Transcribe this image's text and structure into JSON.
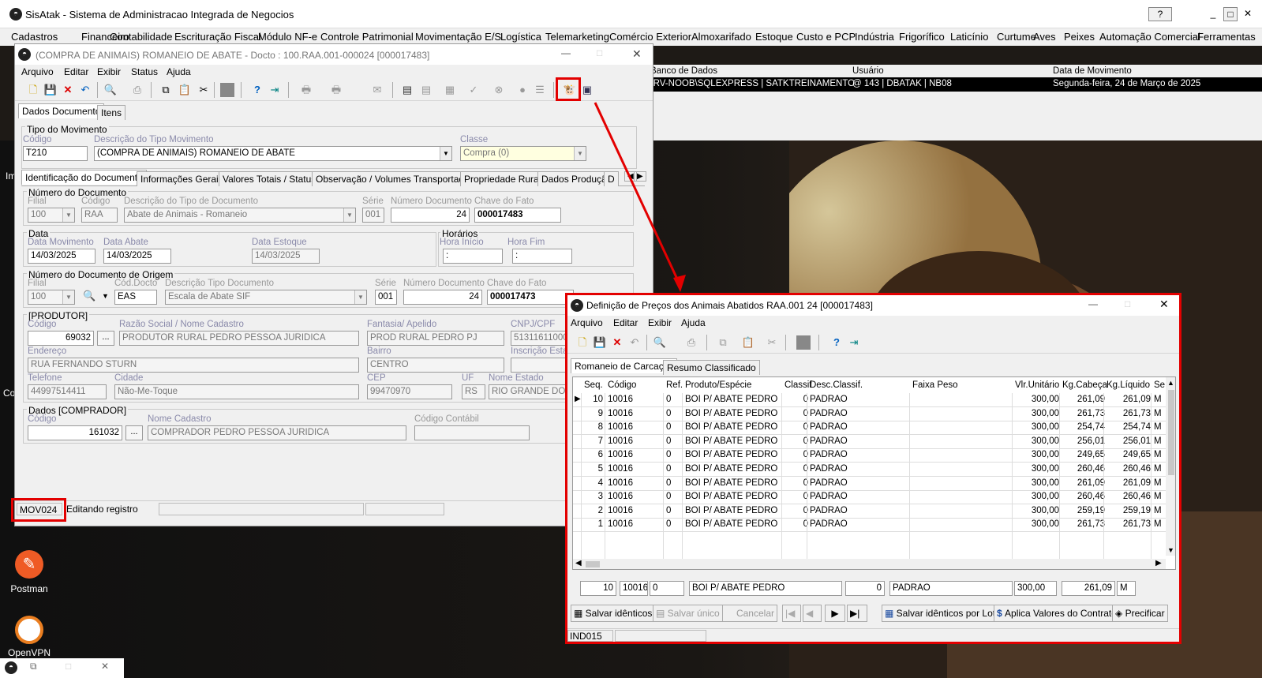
{
  "app": {
    "title": "SisAtak - Sistema de Administracao Integrada de Negocios",
    "help": "?"
  },
  "menu": [
    "Cadastros",
    "Financeiro",
    "Contabilidade",
    "Escrituração Fiscal",
    "Módulo NF-e",
    "Controle Patrimonial",
    "Movimentação E/S",
    "Logística",
    "Telemarketing",
    "Comércio Exterior",
    "Almoxarifado",
    "Estoque",
    "Custo e PCP",
    "Indústria",
    "Frigorífico",
    "Laticínio",
    "Curtume",
    "Aves",
    "Peixes",
    "Automação Comercial",
    "Ferramentas"
  ],
  "info": {
    "h_banco": "Banco de Dados",
    "h_usuario": "Usuário",
    "h_data": "Data de Movimento",
    "banco": "SRV-NOOB\\SQLEXPRESS | SATKTREINAMENTO",
    "usuario": "@ 143 | DBATAK | NB08",
    "data": "Segunda-feira, 24 de Março de 2025"
  },
  "w1": {
    "title": "(COMPRA DE ANIMAIS) ROMANEIO DE ABATE - Docto : 100.RAA.001-000024 [000017483]",
    "menu": [
      "Arquivo",
      "Editar",
      "Exibir",
      "Status",
      "Ajuda"
    ],
    "tabs": [
      "Dados Documento",
      "Itens"
    ],
    "tipo_grp": "Tipo do Movimento",
    "l_codigo": "Código",
    "codigo": "T210",
    "l_desc": "Descrição do Tipo Movimento",
    "desc": "(COMPRA DE ANIMAIS) ROMANEIO DE ABATE",
    "l_classe": "Classe",
    "classe": "Compra (0)",
    "subtabs": [
      "Identificação do Documento",
      "Informações Gerais",
      "Valores Totais / Status",
      "Observação / Volumes Transportados",
      "Propriedade Rural",
      "Dados Produção",
      "D"
    ],
    "num_grp": "Número do Documento",
    "l_filial": "Filial",
    "filial": "100",
    "l_cod": "Código",
    "cod": "RAA",
    "l_desc_doc": "Descrição do Tipo de Documento",
    "desc_doc": "Abate de Animais - Romaneio",
    "l_serie": "Série",
    "serie": "001",
    "l_numdoc": "Número Documento",
    "numdoc": "24",
    "l_chave": "Chave do Fato",
    "chave": "000017483",
    "data_grp": "Data",
    "l_dmov": "Data Movimento",
    "dmov": "14/03/2025",
    "l_dabate": "Data Abate",
    "dabate": "14/03/2025",
    "l_dest": "Data Estoque",
    "dest": "14/03/2025",
    "hor_grp": "Horários",
    "l_hini": "Hora Início",
    "hini": ":",
    "l_hfim": "Hora Fim",
    "hfim": ":",
    "orig_grp": "Número do Documento de Origem",
    "o_filial": "100",
    "l_cdocto": "Cód.Docto",
    "cdocto": "EAS",
    "l_odesc": "Descrição Tipo Documento",
    "odesc": "Escala de Abate SIF",
    "o_serie": "001",
    "o_num": "24",
    "o_chave": "000017473",
    "prod_grp": "[PRODUTOR]",
    "p_codigo": "69032",
    "l_razao": "Razão Social / Nome Cadastro",
    "razao": "PRODUTOR RURAL PEDRO PESSOA JURIDICA",
    "l_fantasia": "Fantasia/ Apelido",
    "fantasia": "PROD RURAL PEDRO PJ",
    "l_cnpj": "CNPJ/CPF",
    "cnpj": "51311611000",
    "l_end": "Endereço",
    "end": "RUA FERNANDO STURN",
    "l_bairro": "Bairro",
    "bairro": "CENTRO",
    "l_insc": "Inscrição Esta",
    "l_tel": "Telefone",
    "tel": "44997514411",
    "l_cidade": "Cidade",
    "cidade": "Não-Me-Toque",
    "l_cep": "CEP",
    "cep": "99470970",
    "l_uf": "UF",
    "uf": "RS",
    "l_nest": "Nome Estado",
    "nest": "RIO GRANDE DO S",
    "comp_grp": "Dados [COMPRADOR]",
    "c_codigo": "161032",
    "l_nomecad": "Nome Cadastro",
    "nomecad": "COMPRADOR PEDRO PESSOA JURIDICA",
    "l_contabil": "Código Contábil",
    "dots": "...",
    "status_code": "MOV024",
    "status_text": "Editando registro"
  },
  "w2": {
    "title": "Definição de Preços dos Animais Abatidos  RAA.001 24 [000017483]",
    "menu": [
      "Arquivo",
      "Editar",
      "Exibir",
      "Ajuda"
    ],
    "tabs": [
      "Romaneio de Carcaças",
      "Resumo Classificado"
    ],
    "cols": [
      "Seq.",
      "Código",
      "Ref.",
      "Produto/Espécie",
      "Classif",
      "Desc.Classif.",
      "Faixa Peso",
      "Vlr.Unitário",
      "Kg.Cabeça",
      "Kg.Líquido",
      "Se"
    ],
    "rows": [
      [
        "10",
        "10016",
        "0",
        "BOI P/ ABATE PEDRO",
        "0",
        "PADRAO",
        "",
        "300,00",
        "261,09",
        "261,09",
        "M"
      ],
      [
        "9",
        "10016",
        "0",
        "BOI P/ ABATE PEDRO",
        "0",
        "PADRAO",
        "",
        "300,00",
        "261,73",
        "261,73",
        "M"
      ],
      [
        "8",
        "10016",
        "0",
        "BOI P/ ABATE PEDRO",
        "0",
        "PADRAO",
        "",
        "300,00",
        "254,74",
        "254,74",
        "M"
      ],
      [
        "7",
        "10016",
        "0",
        "BOI P/ ABATE PEDRO",
        "0",
        "PADRAO",
        "",
        "300,00",
        "256,01",
        "256,01",
        "M"
      ],
      [
        "6",
        "10016",
        "0",
        "BOI P/ ABATE PEDRO",
        "0",
        "PADRAO",
        "",
        "300,00",
        "249,65",
        "249,65",
        "M"
      ],
      [
        "5",
        "10016",
        "0",
        "BOI P/ ABATE PEDRO",
        "0",
        "PADRAO",
        "",
        "300,00",
        "260,46",
        "260,46",
        "M"
      ],
      [
        "4",
        "10016",
        "0",
        "BOI P/ ABATE PEDRO",
        "0",
        "PADRAO",
        "",
        "300,00",
        "261,09",
        "261,09",
        "M"
      ],
      [
        "3",
        "10016",
        "0",
        "BOI P/ ABATE PEDRO",
        "0",
        "PADRAO",
        "",
        "300,00",
        "260,46",
        "260,46",
        "M"
      ],
      [
        "2",
        "10016",
        "0",
        "BOI P/ ABATE PEDRO",
        "0",
        "PADRAO",
        "",
        "300,00",
        "259,19",
        "259,19",
        "M"
      ],
      [
        "1",
        "10016",
        "0",
        "BOI P/ ABATE PEDRO",
        "0",
        "PADRAO",
        "",
        "300,00",
        "261,73",
        "261,73",
        "M"
      ]
    ],
    "edit": {
      "seq": "10",
      "cod": "10016",
      "ref": "0",
      "prod": "BOI P/ ABATE PEDRO",
      "classif": "0",
      "desc": "PADRAO",
      "vlr": "300,00",
      "kg": "261,09",
      "se": "M"
    },
    "btns": {
      "salvar_id": "Salvar idênticos",
      "salvar_un": "Salvar único",
      "cancelar": "Cancelar",
      "salvar_lote": "Salvar idênticos por Lote",
      "aplica": "Aplica Valores do Contrato",
      "precificar": "Precificar"
    },
    "status": "IND015"
  },
  "desktop": {
    "postman": "Postman",
    "openvpn": "OpenVPN",
    "frag1": "Im",
    "frag2": "Co"
  },
  "colors": {
    "highlight": "#e30000"
  }
}
